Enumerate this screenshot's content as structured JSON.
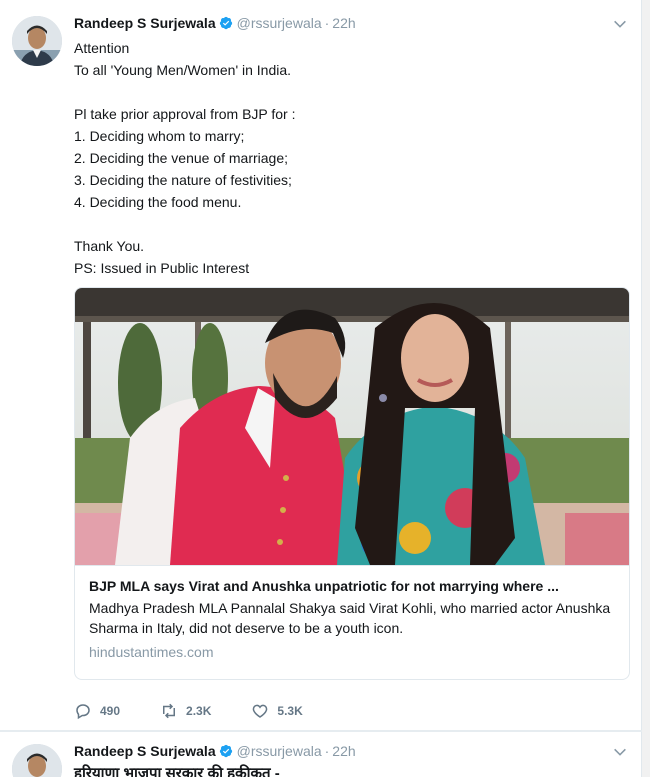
{
  "tweets": [
    {
      "author": {
        "name": "Randeep S Surjewala",
        "handle": "@rssurjewala",
        "verified": true,
        "time": "22h"
      },
      "text_lines": [
        "Attention",
        "To all 'Young Men/Women' in India.",
        "",
        "Pl take prior approval from BJP for :",
        "1. Deciding whom to marry;",
        "2. Deciding the venue of marriage;",
        "3. Deciding the nature of festivities;",
        "4. Deciding the food menu.",
        "",
        "Thank You.",
        "PS: Issued in Public Interest"
      ],
      "card": {
        "title": "BJP MLA says Virat and Anushka unpatriotic for not marrying where ...",
        "description": "Madhya Pradesh MLA Pannalal Shakya said Virat Kohli, who married actor Anushka Sharma in Italy, did not deserve to be a youth icon.",
        "domain": "hindustantimes.com"
      },
      "actions": {
        "replies": "490",
        "retweets": "2.3K",
        "likes": "5.3K"
      }
    },
    {
      "author": {
        "name": "Randeep S Surjewala",
        "handle": "@rssurjewala",
        "verified": true,
        "time": "22h"
      },
      "text_partial": "हरियाणा भाजपा सरकार की हकीकत -"
    }
  ],
  "icons": {
    "verified": "verified-badge-icon",
    "caret": "chevron-down-icon",
    "reply": "reply-icon",
    "retweet": "retweet-icon",
    "like": "heart-icon"
  },
  "colors": {
    "verified": "#1da1f2",
    "muted": "#8899a6",
    "action": "#657786",
    "border": "#e1e8ed"
  }
}
